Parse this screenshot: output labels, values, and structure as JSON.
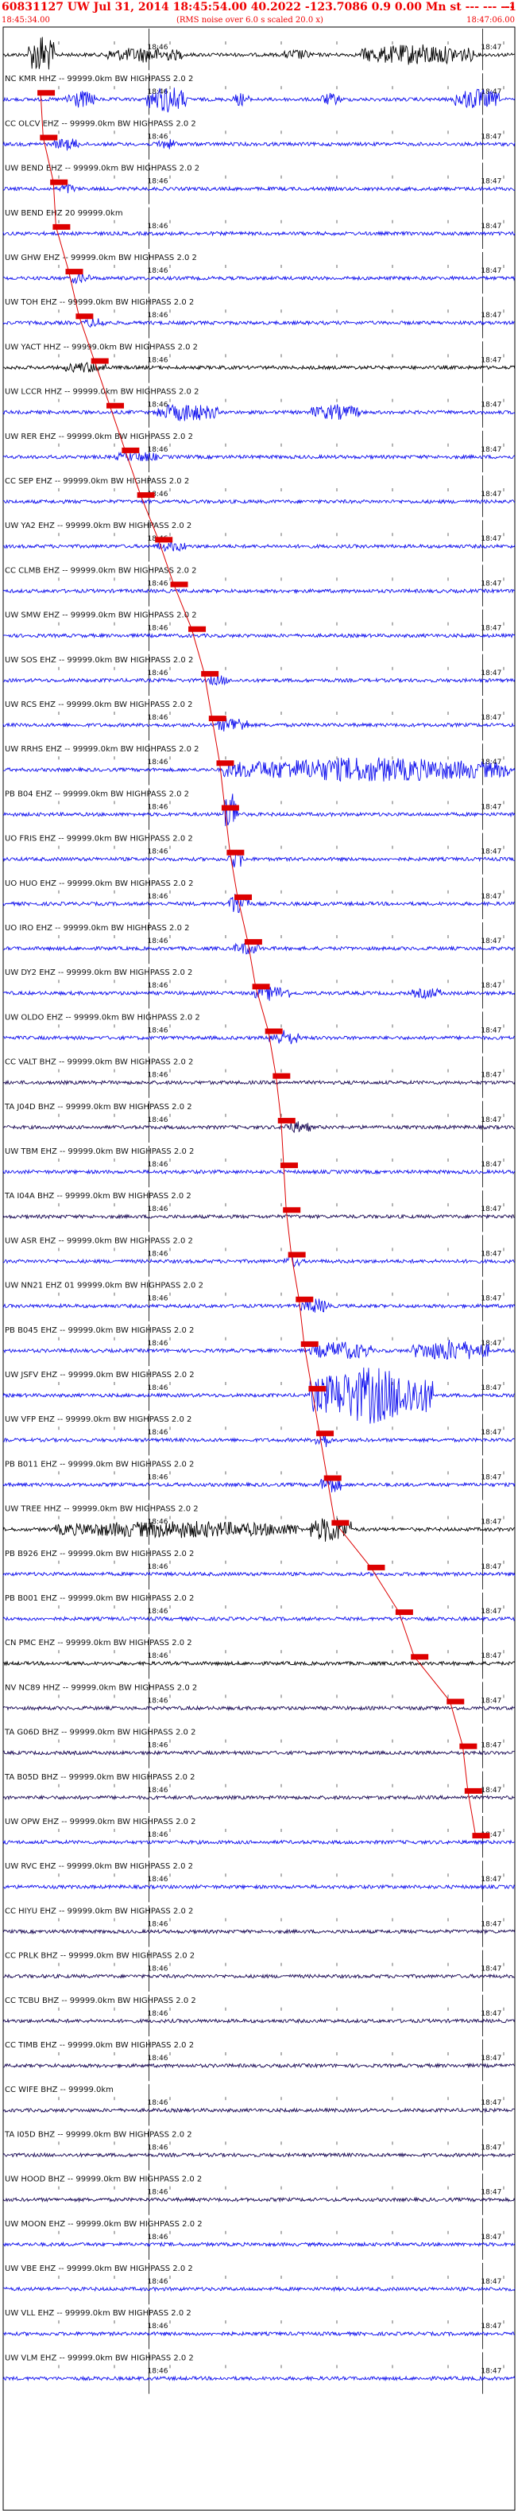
{
  "header": {
    "title": "60831127 UW Jul 31, 2014 18:45:54.00   40.2022  -123.7086   0.9  0.00  Mn st --- --- ---",
    "title_right": "-1",
    "start_time": "18:45:34.00",
    "note": "(RMS noise over 6.0 s scaled 20.0 x)",
    "end_time": "18:47:06.00"
  },
  "time_labels": [
    "18:46",
    "18:47"
  ],
  "colors": {
    "trace_blue": "#1010ee",
    "trace_dark": "#1a0a55",
    "trace_black": "#000000",
    "pick": "#dd0000",
    "grid": "#000000"
  },
  "chart_data": {
    "type": "seismogram",
    "x_range": [
      "18:45:34.00",
      "18:47:06.00"
    ],
    "tick_labels": [
      "18:46",
      "18:47"
    ],
    "series": [
      {
        "name": "",
        "label": "",
        "color": "black",
        "pick": null,
        "events": [
          [
            0.05,
            0.1,
            2.6
          ],
          [
            0.2,
            0.35,
            0.8
          ],
          [
            0.55,
            0.6,
            0.5
          ],
          [
            0.7,
            0.92,
            1.2
          ]
        ]
      },
      {
        "name": "NC.KMR",
        "label": "NC KMR HHZ -- 99999.0km BW  HIGHPASS  2.0  2",
        "color": "blue",
        "pick": 0.07,
        "events": [
          [
            0.12,
            0.18,
            1.0
          ],
          [
            0.28,
            0.36,
            1.6
          ],
          [
            0.45,
            0.48,
            0.7
          ],
          [
            0.62,
            0.66,
            0.6
          ],
          [
            0.88,
            0.97,
            1.2
          ]
        ]
      },
      {
        "name": "CC.OLCV",
        "label": "CC OLCV EHZ -- 99999.0km BW  HIGHPASS  2.0  2",
        "color": "blue",
        "pick": 0.075,
        "events": [
          [
            0.1,
            0.15,
            0.6
          ],
          [
            0.3,
            0.34,
            0.5
          ]
        ]
      },
      {
        "name": "UW.BEND.EHZ",
        "label": "UW BEND EHZ -- 99999.0km BW  HIGHPASS  2.0  2",
        "color": "blue",
        "pick": 0.095,
        "events": [
          [
            0.11,
            0.14,
            0.5
          ]
        ]
      },
      {
        "name": "UW.BEND.EHZ20",
        "label": "UW BEND EHZ 20 99999.0km",
        "color": "blue",
        "pick": 0.1,
        "events": []
      },
      {
        "name": "UW.GHW",
        "label": "UW GHW EHZ -- 99999.0km BW  HIGHPASS  2.0  2",
        "color": "blue",
        "pick": 0.125,
        "events": [
          [
            0.13,
            0.17,
            0.6
          ]
        ]
      },
      {
        "name": "UW.TOH",
        "label": "UW TOH EHZ -- 99999.0km BW  HIGHPASS  2.0  2",
        "color": "blue",
        "pick": 0.145,
        "events": [
          [
            0.16,
            0.2,
            0.5
          ]
        ]
      },
      {
        "name": "UW.YACT",
        "label": "UW YACT HHZ -- 99999.0km BW  HIGHPASS  2.0  2",
        "color": "black",
        "pick": 0.175,
        "events": [
          [
            0.12,
            0.2,
            0.5
          ]
        ]
      },
      {
        "name": "UW.LCCR",
        "label": "UW LCCR HHZ -- 99999.0km BW  HIGHPASS  2.0  2",
        "color": "blue",
        "pick": 0.205,
        "events": [
          [
            0.3,
            0.42,
            1.0
          ],
          [
            0.6,
            0.7,
            0.8
          ]
        ]
      },
      {
        "name": "UW.RER",
        "label": "UW RER EHZ -- 99999.0km BW  HIGHPASS  2.0  2",
        "color": "blue",
        "pick": 0.235,
        "events": [
          [
            0.22,
            0.3,
            0.5
          ]
        ]
      },
      {
        "name": "CC.SEP",
        "label": "CC SEP EHZ -- 99999.0km BW  HIGHPASS  2.0  2",
        "color": "blue",
        "pick": 0.265,
        "events": []
      },
      {
        "name": "UW.YA2",
        "label": "UW YA2 EHZ -- 99999.0km BW  HIGHPASS  2.0  2",
        "color": "blue",
        "pick": 0.3,
        "events": [
          [
            0.3,
            0.36,
            0.5
          ]
        ]
      },
      {
        "name": "CC.CLMB",
        "label": "CC CLMB EHZ -- 99999.0km BW  HIGHPASS  2.0  2",
        "color": "blue",
        "pick": 0.33,
        "events": []
      },
      {
        "name": "UW.SMW",
        "label": "UW SMW EHZ -- 99999.0km BW  HIGHPASS  2.0  2",
        "color": "blue",
        "pick": 0.365,
        "events": []
      },
      {
        "name": "UW.SOS",
        "label": "UW SOS EHZ -- 99999.0km BW  HIGHPASS  2.0  2",
        "color": "blue",
        "pick": 0.39,
        "events": [
          [
            0.4,
            0.44,
            0.5
          ]
        ]
      },
      {
        "name": "UW.RCS",
        "label": "UW RCS EHZ -- 99999.0km BW  HIGHPASS  2.0  2",
        "color": "blue",
        "pick": 0.405,
        "events": [
          [
            0.42,
            0.48,
            0.9
          ]
        ]
      },
      {
        "name": "UW.RRHS",
        "label": "UW RRHS EHZ -- 99999.0km BW  HIGHPASS  2.0  2",
        "color": "blue",
        "pick": 0.42,
        "events": [
          [
            0.43,
            0.99,
            1.4
          ]
        ]
      },
      {
        "name": "PB.B04",
        "label": "PB B04 EHZ -- 99999.0km BW  HIGHPASS  2.0  2",
        "color": "blue",
        "pick": 0.43,
        "events": [
          [
            0.43,
            0.46,
            3.0
          ]
        ]
      },
      {
        "name": "UO.FRIS",
        "label": "UO FRIS EHZ -- 99999.0km BW  HIGHPASS  2.0  2",
        "color": "blue",
        "pick": 0.44,
        "events": [
          [
            0.44,
            0.47,
            1.2
          ]
        ]
      },
      {
        "name": "UO.HUO",
        "label": "UO HUO EHZ -- 99999.0km BW  HIGHPASS  2.0  2",
        "color": "blue",
        "pick": 0.455,
        "events": [
          [
            0.44,
            0.48,
            1.5
          ]
        ]
      },
      {
        "name": "UO.IRO",
        "label": "UO IRO EHZ -- 99999.0km BW  HIGHPASS  2.0  2",
        "color": "blue",
        "pick": 0.475,
        "events": [
          [
            0.45,
            0.5,
            0.6
          ]
        ]
      },
      {
        "name": "UW.DY2",
        "label": "UW DY2 EHZ -- 99999.0km BW  HIGHPASS  2.0  2",
        "color": "blue",
        "pick": 0.49,
        "events": [
          [
            0.49,
            0.56,
            0.8
          ],
          [
            0.8,
            0.86,
            0.5
          ]
        ]
      },
      {
        "name": "UW.OLDO",
        "label": "UW OLDO EHZ -- 99999.0km BW  HIGHPASS  2.0  2",
        "color": "blue",
        "pick": 0.515,
        "events": [
          [
            0.52,
            0.58,
            0.8
          ]
        ]
      },
      {
        "name": "CC.VALT",
        "label": "CC VALT BHZ -- 99999.0km BW  HIGHPASS  2.0  2",
        "color": "dark",
        "pick": 0.53,
        "events": []
      },
      {
        "name": "TA.J04D",
        "label": "TA J04D BHZ -- 99999.0km BW  HIGHPASS  2.0  2",
        "color": "dark",
        "pick": 0.54,
        "events": [
          [
            0.55,
            0.6,
            0.6
          ]
        ]
      },
      {
        "name": "UW.TBM",
        "label": "UW TBM EHZ -- 99999.0km BW  HIGHPASS  2.0  2",
        "color": "blue",
        "pick": 0.545,
        "events": []
      },
      {
        "name": "TA.I04A",
        "label": "TA I04A BHZ -- 99999.0km BW  HIGHPASS  2.0  2",
        "color": "dark",
        "pick": 0.55,
        "events": []
      },
      {
        "name": "UW.ASR",
        "label": "UW ASR EHZ -- 99999.0km BW  HIGHPASS  2.0  2",
        "color": "blue",
        "pick": 0.56,
        "events": [
          [
            0.55,
            0.58,
            0.7
          ]
        ]
      },
      {
        "name": "UW.NN21",
        "label": "UW NN21 EHZ 01 99999.0km BW  HIGHPASS  2.0  2",
        "color": "blue",
        "pick": 0.575,
        "events": [
          [
            0.58,
            0.64,
            0.8
          ]
        ]
      },
      {
        "name": "PB.B045",
        "label": "PB B045 EHZ -- 99999.0km BW  HIGHPASS  2.0  2",
        "color": "blue",
        "pick": 0.585,
        "events": [
          [
            0.6,
            0.72,
            1.0
          ],
          [
            0.8,
            0.95,
            1.2
          ]
        ]
      },
      {
        "name": "UW.JSFV",
        "label": "UW JSFV EHZ -- 99999.0km BW  HIGHPASS  2.0  2",
        "color": "blue",
        "pick": 0.6,
        "events": [
          [
            0.6,
            0.84,
            3.5
          ]
        ]
      },
      {
        "name": "UW.VFP",
        "label": "UW VFP EHZ -- 99999.0km BW  HIGHPASS  2.0  2",
        "color": "blue",
        "pick": 0.615,
        "events": [
          [
            0.61,
            0.64,
            0.9
          ]
        ]
      },
      {
        "name": "PB.B011",
        "label": "PB B011 EHZ -- 99999.0km BW  HIGHPASS  2.0  2",
        "color": "blue",
        "pick": 0.63,
        "events": [
          [
            0.62,
            0.66,
            1.0
          ]
        ]
      },
      {
        "name": "UW.TREE",
        "label": "UW TREE HHZ -- 99999.0km BW  HIGHPASS  2.0  2",
        "color": "black",
        "pick": 0.645,
        "events": [
          [
            0.1,
            0.58,
            0.9
          ],
          [
            0.6,
            0.68,
            1.6
          ]
        ]
      },
      {
        "name": "PB.B926",
        "label": "PB B926 EHZ -- 99999.0km BW  HIGHPASS  2.0  2",
        "color": "blue",
        "pick": 0.715,
        "events": []
      },
      {
        "name": "PB.B001",
        "label": "PB B001 EHZ -- 99999.0km BW  HIGHPASS  2.0  2",
        "color": "blue",
        "pick": 0.77,
        "events": []
      },
      {
        "name": "CN.PMC",
        "label": "CN PMC EHZ -- 99999.0km BW  HIGHPASS  2.0  2",
        "color": "black",
        "pick": 0.8,
        "events": []
      },
      {
        "name": "NV.NC89",
        "label": "NV NC89 HHZ -- 99999.0km BW  HIGHPASS  2.0  2",
        "color": "dark",
        "pick": 0.87,
        "events": []
      },
      {
        "name": "TA.G06D",
        "label": "TA G06D BHZ -- 99999.0km BW  HIGHPASS  2.0  2",
        "color": "dark",
        "pick": 0.895,
        "events": []
      },
      {
        "name": "TA.B05D",
        "label": "TA B05D BHZ -- 99999.0km BW  HIGHPASS  2.0  2",
        "color": "dark",
        "pick": 0.905,
        "events": []
      },
      {
        "name": "UW.OPW",
        "label": "UW OPW EHZ -- 99999.0km BW  HIGHPASS  2.0  2",
        "color": "blue",
        "pick": 0.92,
        "events": []
      },
      {
        "name": "UW.RVC",
        "label": "UW RVC EHZ -- 99999.0km BW  HIGHPASS  2.0  2",
        "color": "blue",
        "pick": null,
        "events": []
      },
      {
        "name": "CC.HIYU",
        "label": "CC HIYU EHZ -- 99999.0km BW  HIGHPASS  2.0  2",
        "color": "dark",
        "pick": null,
        "events": []
      },
      {
        "name": "CC.PRLK",
        "label": "CC PRLK BHZ -- 99999.0km BW  HIGHPASS  2.0  2",
        "color": "dark",
        "pick": null,
        "events": []
      },
      {
        "name": "CC.TCBU",
        "label": "CC TCBU BHZ -- 99999.0km BW  HIGHPASS  2.0  2",
        "color": "dark",
        "pick": null,
        "events": []
      },
      {
        "name": "CC.TIMB",
        "label": "CC TIMB EHZ -- 99999.0km BW  HIGHPASS  2.0  2",
        "color": "dark",
        "pick": null,
        "events": []
      },
      {
        "name": "CC.WIFE",
        "label": "CC WIFE BHZ -- 99999.0km",
        "color": "dark",
        "pick": null,
        "events": []
      },
      {
        "name": "TA.I05D",
        "label": "TA I05D BHZ -- 99999.0km BW  HIGHPASS  2.0  2",
        "color": "dark",
        "pick": null,
        "events": []
      },
      {
        "name": "UW.HOOD",
        "label": "UW HOOD BHZ -- 99999.0km BW  HIGHPASS  2.0  2",
        "color": "dark",
        "pick": null,
        "events": []
      },
      {
        "name": "UW.MOON",
        "label": "UW MOON EHZ -- 99999.0km BW  HIGHPASS  2.0  2",
        "color": "blue",
        "pick": null,
        "events": []
      },
      {
        "name": "UW.VBE",
        "label": "UW VBE EHZ -- 99999.0km BW  HIGHPASS  2.0  2",
        "color": "blue",
        "pick": null,
        "events": []
      },
      {
        "name": "UW.VLL",
        "label": "UW VLL EHZ -- 99999.0km BW  HIGHPASS  2.0  2",
        "color": "blue",
        "pick": null,
        "events": []
      },
      {
        "name": "UW.VLM",
        "label": "UW VLM EHZ -- 99999.0km BW  HIGHPASS  2.0  2",
        "color": "blue",
        "pick": null,
        "events": []
      }
    ]
  }
}
